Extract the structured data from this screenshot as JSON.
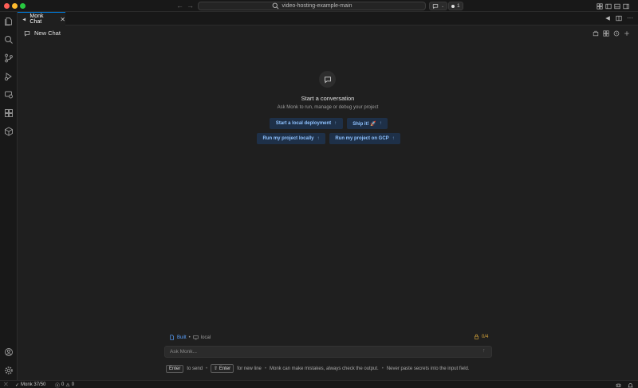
{
  "titlebar": {
    "search_text": "video-hosting-example-main",
    "badge_count": "1"
  },
  "tab": {
    "label": "Monk Chat"
  },
  "chat": {
    "title": "New Chat"
  },
  "empty_state": {
    "title": "Start a conversation",
    "subtitle": "Ask Monk to run, manage or debug your project"
  },
  "suggestions": [
    {
      "label": "Start a local deployment"
    },
    {
      "label": "Ship it! 🚀"
    },
    {
      "label": "Run my project locally"
    },
    {
      "label": "Run my project on GCP"
    }
  ],
  "input": {
    "status_built": "Built",
    "separator": "•",
    "env": "local",
    "quota": "0/4",
    "placeholder": "Ask Monk...",
    "value": ""
  },
  "hint": {
    "enter_key": "Enter",
    "to_send": "to send",
    "shift_enter_key": "⇧ Enter",
    "new_line": "for new line",
    "disclaimer": "Monk can make mistakes, always check the output.",
    "secrets_warning": "Never paste secrets into the input field."
  },
  "statusbar": {
    "monk_status": "Monk 37/50",
    "errors": "0",
    "warnings": "0"
  },
  "colors": {
    "accent": "#0078d4",
    "suggestion_bg": "#1e3048",
    "suggestion_text": "#8fc2ff",
    "quota": "#d7a53a"
  }
}
